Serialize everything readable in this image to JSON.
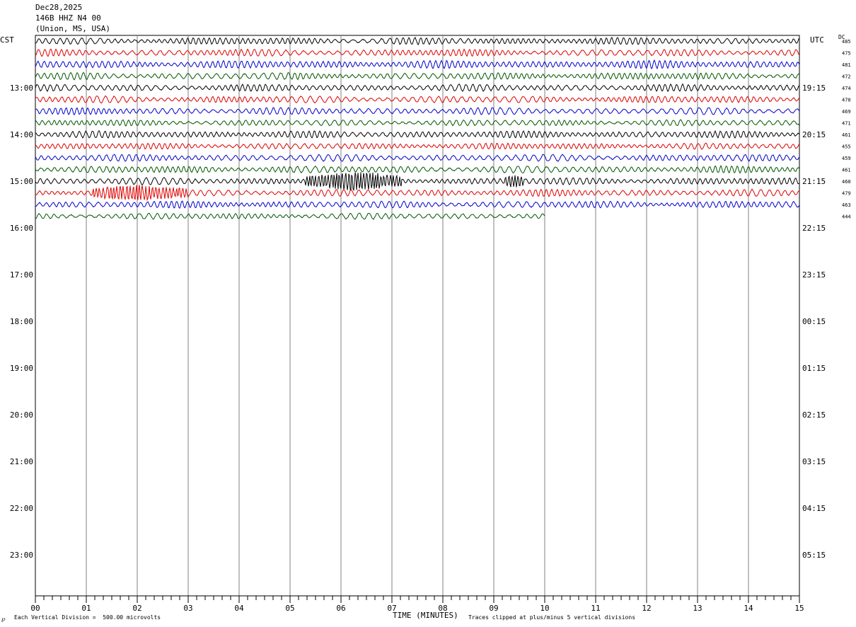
{
  "header": {
    "date": "Dec28,2025",
    "station": "146B HHZ N4 00",
    "location": "(Union, MS, USA)"
  },
  "left_axis_title": "CST",
  "right_axis_title": "UTC",
  "dc_label": "DC",
  "footer": {
    "x_title": "TIME (MINUTES)",
    "scale_note": "Each Vertical Division =  500.00 microvolts",
    "clip_note": "Traces clipped at plus/minus 5 vertical divisions",
    "corner_mark": "℘"
  },
  "colors": {
    "trace_cycle": [
      "#000000",
      "#dd0000",
      "#0000cc",
      "#005500"
    ],
    "grid": "#808080",
    "axis": "#000000"
  },
  "chart_data": {
    "type": "seismogram",
    "x_range_minutes": [
      0,
      15
    ],
    "x_tick_labels": [
      "00",
      "01",
      "02",
      "03",
      "04",
      "05",
      "06",
      "07",
      "08",
      "09",
      "10",
      "11",
      "12",
      "13",
      "14",
      "15"
    ],
    "left_hour_labels": [
      {
        "row": 4,
        "label": "13:00"
      },
      {
        "row": 8,
        "label": "14:00"
      },
      {
        "row": 12,
        "label": "15:00"
      },
      {
        "row": 16,
        "label": "16:00"
      },
      {
        "row": 20,
        "label": "17:00"
      },
      {
        "row": 24,
        "label": "18:00"
      },
      {
        "row": 28,
        "label": "19:00"
      },
      {
        "row": 32,
        "label": "20:00"
      },
      {
        "row": 36,
        "label": "21:00"
      },
      {
        "row": 40,
        "label": "22:00"
      },
      {
        "row": 44,
        "label": "23:00"
      }
    ],
    "right_hour_labels": [
      {
        "row": 4,
        "label": "19:15"
      },
      {
        "row": 8,
        "label": "20:15"
      },
      {
        "row": 12,
        "label": "21:15"
      },
      {
        "row": 16,
        "label": "22:15"
      },
      {
        "row": 20,
        "label": "23:15"
      },
      {
        "row": 24,
        "label": "00:15"
      },
      {
        "row": 28,
        "label": "01:15"
      },
      {
        "row": 32,
        "label": "02:15"
      },
      {
        "row": 36,
        "label": "03:15"
      },
      {
        "row": 40,
        "label": "04:15"
      },
      {
        "row": 44,
        "label": "05:15"
      }
    ],
    "total_rows": 48,
    "dc_offsets": [
      "485",
      "475",
      "481",
      "472",
      "474",
      "470",
      "469",
      "471",
      "461",
      "455",
      "459",
      "461",
      "460",
      "479",
      "463",
      "444"
    ],
    "traces": [
      {
        "row": 0,
        "end_minute": 15,
        "amplitude": 0.8,
        "bursts": []
      },
      {
        "row": 1,
        "end_minute": 15,
        "amplitude": 0.8,
        "bursts": []
      },
      {
        "row": 2,
        "end_minute": 15,
        "amplitude": 0.9,
        "bursts": []
      },
      {
        "row": 3,
        "end_minute": 15,
        "amplitude": 0.8,
        "bursts": []
      },
      {
        "row": 4,
        "end_minute": 15,
        "amplitude": 0.8,
        "bursts": []
      },
      {
        "row": 5,
        "end_minute": 15,
        "amplitude": 0.8,
        "bursts": []
      },
      {
        "row": 6,
        "end_minute": 15,
        "amplitude": 0.8,
        "bursts": []
      },
      {
        "row": 7,
        "end_minute": 15,
        "amplitude": 0.7,
        "bursts": []
      },
      {
        "row": 8,
        "end_minute": 15,
        "amplitude": 0.8,
        "bursts": []
      },
      {
        "row": 9,
        "end_minute": 15,
        "amplitude": 0.7,
        "bursts": []
      },
      {
        "row": 10,
        "end_minute": 15,
        "amplitude": 0.8,
        "bursts": []
      },
      {
        "row": 11,
        "end_minute": 15,
        "amplitude": 0.8,
        "bursts": []
      },
      {
        "row": 12,
        "end_minute": 15,
        "amplitude": 0.8,
        "bursts": [
          [
            5.3,
            7.2,
            2.2
          ],
          [
            9.2,
            9.6,
            1.4
          ]
        ]
      },
      {
        "row": 13,
        "end_minute": 15,
        "amplitude": 0.8,
        "bursts": [
          [
            1.1,
            3.0,
            1.6
          ]
        ]
      },
      {
        "row": 14,
        "end_minute": 15,
        "amplitude": 0.8,
        "bursts": []
      },
      {
        "row": 15,
        "end_minute": 10,
        "amplitude": 0.7,
        "bursts": []
      }
    ]
  }
}
